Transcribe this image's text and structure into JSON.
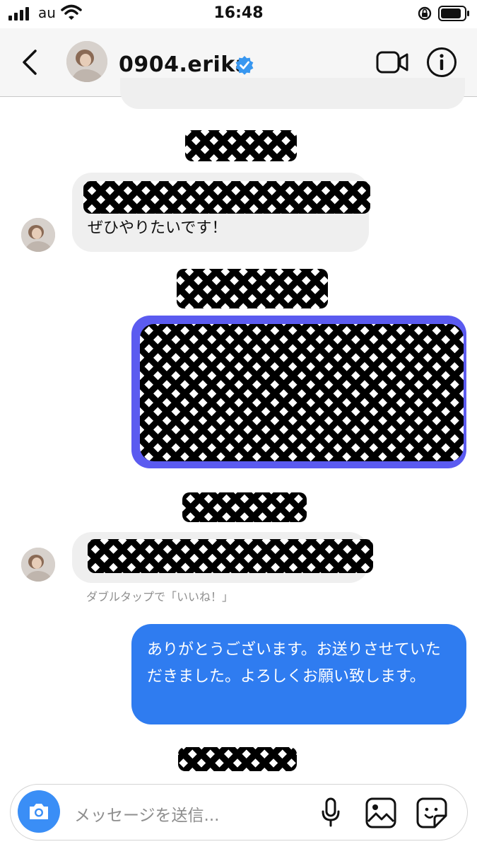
{
  "status_bar": {
    "carrier": "au",
    "time": "16:48"
  },
  "header": {
    "back_icon": "chevron-left-icon",
    "username": "0904.erika",
    "verified_icon": "verified-badge-icon",
    "video_icon": "video-call-icon",
    "info_icon": "info-icon"
  },
  "messages": [
    {
      "direction": "incoming",
      "text": "ぜひやりたいです！",
      "redacted_line_above": true
    },
    {
      "direction": "outgoing",
      "redacted": true,
      "accent": "#5b5bf0"
    },
    {
      "direction": "incoming",
      "redacted": true
    },
    {
      "direction": "outgoing",
      "text": "ありがとうございます。お送りさせていただきました。よろしくお願い致します。",
      "accent": "#2f7cf0"
    }
  ],
  "double_tap_hint": "ダブルタップで「いいね！」",
  "composer": {
    "placeholder": "メッセージを送信...",
    "camera_icon": "camera-icon",
    "mic_icon": "microphone-icon",
    "gallery_icon": "gallery-icon",
    "sticker_icon": "sticker-icon"
  }
}
